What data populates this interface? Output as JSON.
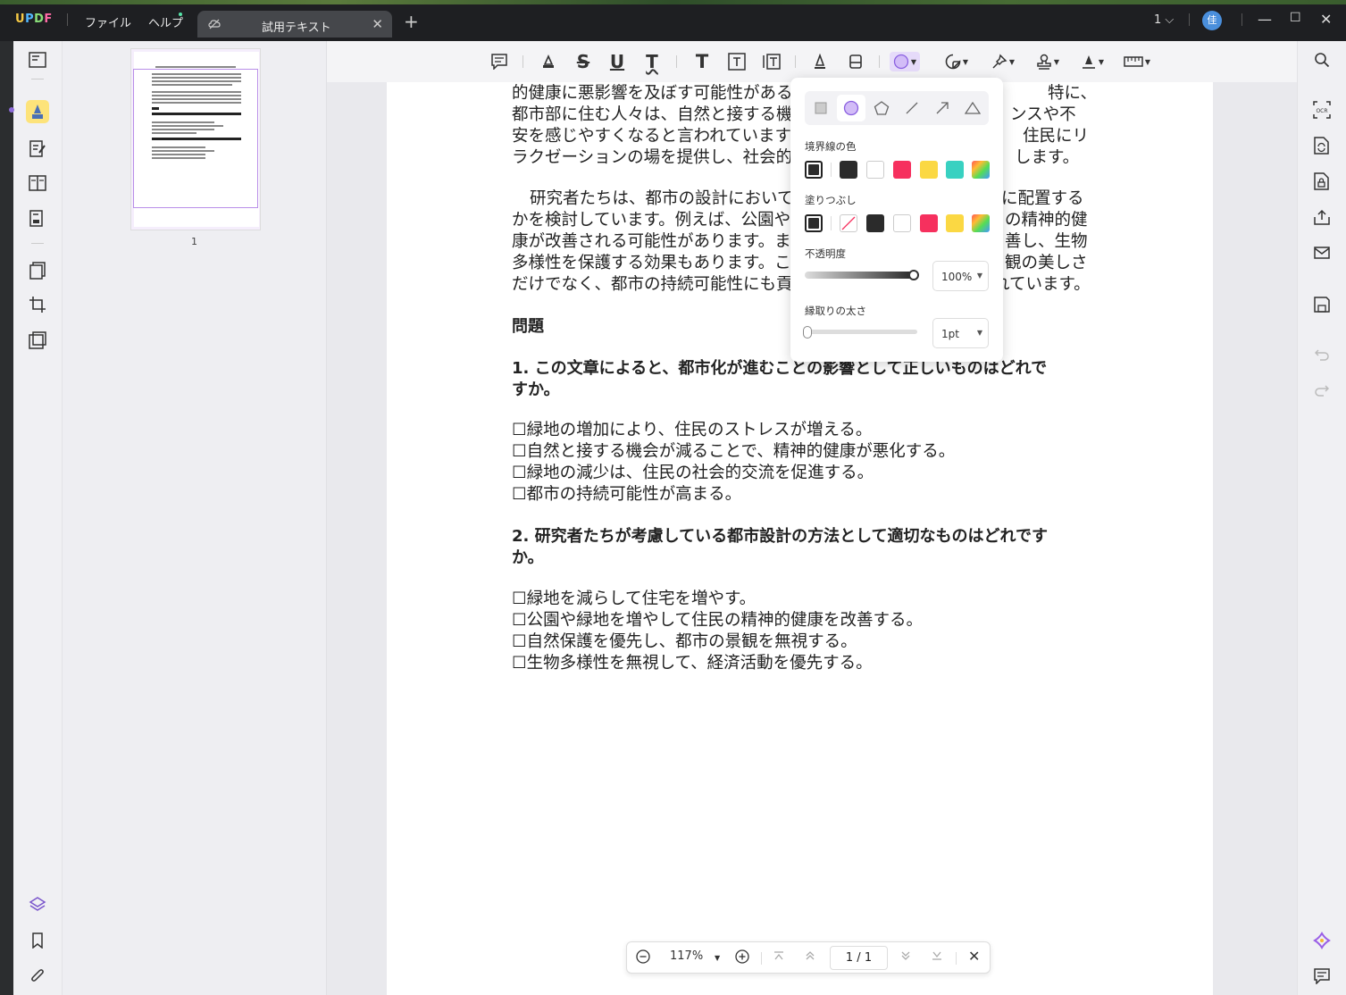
{
  "app": {
    "logo": "UPDF",
    "menu_file": "ファイル",
    "menu_help": "ヘルプ",
    "tab_title": "試用テキスト",
    "tab_close": "✕",
    "tab_add": "+",
    "page_indicator": "1",
    "avatar": "佳"
  },
  "document": {
    "lines": [
      "的健康に悪影響を及ぼす可能性がある",
      "都市部に住む人々は、自然と接する機",
      "安を感じやすくなると言われています",
      "ラクゼーションの場を提供し、社会的",
      "研究者たちは、都市の設計において",
      "かを検討しています。例えば、公園や",
      "康が改善される可能性があります。ま",
      "多様性を保護する効果もあります。こ",
      "だけでなく、都市の持続可能性にも貢"
    ],
    "lines_right": [
      "特に、",
      "ンスや不",
      "住民にリ",
      "します。",
      "に配置する",
      "の精神的健",
      "善し、生物",
      "観の美しさ",
      "れています。"
    ],
    "heading": "問題",
    "q1_line1": "1.  この文章によると、都市化が進むことの影響として正しいものはどれで",
    "q1_line2": "すか。",
    "q1_options": [
      "☐緑地の増加により、住民のストレスが増える。",
      "☐自然と接する機会が減ることで、精神的健康が悪化する。",
      "☐緑地の減少は、住民の社会的交流を促進する。",
      "☐都市の持続可能性が高まる。"
    ],
    "q2_line1": "2.  研究者たちが考慮している都市設計の方法として適切なものはどれです",
    "q2_line2": "か。",
    "q2_options": [
      "☐緑地を減らして住宅を増やす。",
      "☐公園や緑地を増やして住民の精神的健康を改善する。",
      "☐自然保護を優先し、都市の景観を無視する。",
      "☐生物多様性を無視して、経済活動を優先する。"
    ]
  },
  "thumbnail": {
    "page_number": "1"
  },
  "popup": {
    "border_color_label": "境界線の色",
    "fill_label": "塗りつぶし",
    "opacity_label": "不透明度",
    "opacity_value": "100%",
    "opacity_level": 1.0,
    "stroke_label": "縁取りの太さ",
    "stroke_value": "1pt",
    "selected_shape": "circle",
    "border_colors": [
      "#2b2b2b",
      "#2b2b2b",
      "#ffffff",
      "#f6305e",
      "#fbd843",
      "#38d1c1"
    ],
    "fill_colors": [
      "#2b2b2b",
      "none",
      "#2b2b2b",
      "#ffffff",
      "#f6305e",
      "#fbd843"
    ],
    "accent": "#b693f0"
  },
  "zoom": {
    "value": "117%",
    "page_current": "1",
    "page_sep": "/",
    "page_total": "1"
  }
}
